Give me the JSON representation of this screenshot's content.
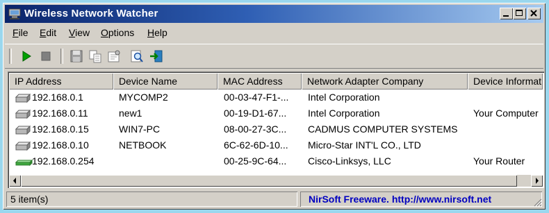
{
  "window": {
    "title": "Wireless Network Watcher"
  },
  "title_buttons": {
    "minimize_icon": "minimize-icon",
    "maximize_icon": "maximize-icon",
    "close_icon": "close-icon"
  },
  "menu": [
    {
      "label": "File",
      "accel": "F",
      "rest": "ile"
    },
    {
      "label": "Edit",
      "accel": "E",
      "rest": "dit"
    },
    {
      "label": "View",
      "accel": "V",
      "rest": "iew"
    },
    {
      "label": "Options",
      "accel": "O",
      "rest": "ptions"
    },
    {
      "label": "Help",
      "accel": "H",
      "rest": "elp"
    }
  ],
  "toolbar": {
    "buttons": [
      "play-icon",
      "stop-icon",
      "save-icon",
      "copy-icon",
      "properties-icon",
      "find-icon",
      "exit-icon"
    ],
    "colors": {
      "play": "#00a000",
      "stop": "#808080"
    }
  },
  "list": {
    "columns": [
      "IP Address",
      "Device Name",
      "MAC Address",
      "Network Adapter Company",
      "Device Informat"
    ],
    "rows": [
      {
        "icon": "computer-icon",
        "ip": "192.168.0.1",
        "name": "MYCOMP2",
        "mac": "00-03-47-F1-...",
        "company": "Intel Corporation",
        "info": ""
      },
      {
        "icon": "computer-icon",
        "ip": "192.168.0.11",
        "name": "new1",
        "mac": "00-19-D1-67...",
        "company": "Intel Corporation",
        "info": "Your Computer"
      },
      {
        "icon": "computer-icon",
        "ip": "192.168.0.15",
        "name": "WIN7-PC",
        "mac": "08-00-27-3C...",
        "company": "CADMUS COMPUTER SYSTEMS",
        "info": ""
      },
      {
        "icon": "computer-icon",
        "ip": "192.168.0.10",
        "name": "NETBOOK",
        "mac": "6C-62-6D-10...",
        "company": "Micro-Star INT'L CO., LTD",
        "info": ""
      },
      {
        "icon": "router-icon",
        "ip": "192.168.0.254",
        "name": "",
        "mac": "00-25-9C-64...",
        "company": "Cisco-Linksys, LLC",
        "info": "Your Router"
      }
    ]
  },
  "status": {
    "count": "5 item(s)",
    "link": "NirSoft Freeware.  http://www.nirsoft.net",
    "link_color": "#0000c0"
  },
  "colors": {
    "titlebar_start": "#0a246a",
    "titlebar_end": "#a6caf0",
    "background": "#9ad7ee",
    "face": "#d4d0c8"
  }
}
